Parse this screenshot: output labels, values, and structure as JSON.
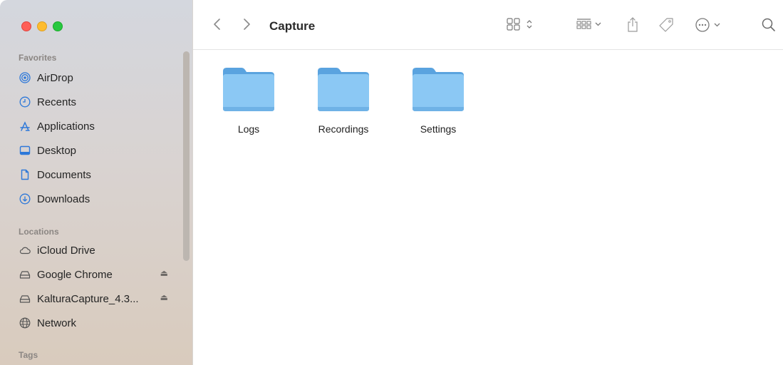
{
  "window": {
    "title": "Capture"
  },
  "sidebar": {
    "sections": [
      {
        "title": "Favorites",
        "items": [
          {
            "label": "AirDrop",
            "icon": "airdrop-icon"
          },
          {
            "label": "Recents",
            "icon": "clock-icon"
          },
          {
            "label": "Applications",
            "icon": "applications-icon"
          },
          {
            "label": "Desktop",
            "icon": "desktop-icon"
          },
          {
            "label": "Documents",
            "icon": "document-icon"
          },
          {
            "label": "Downloads",
            "icon": "download-icon"
          }
        ]
      },
      {
        "title": "Locations",
        "items": [
          {
            "label": "iCloud Drive",
            "icon": "cloud-icon"
          },
          {
            "label": "Google Chrome",
            "icon": "drive-icon",
            "eject": "⏏"
          },
          {
            "label": "KalturaCapture_4.3...",
            "icon": "drive-icon",
            "eject": "⏏"
          },
          {
            "label": "Network",
            "icon": "globe-icon"
          }
        ]
      },
      {
        "title": "Tags",
        "items": []
      }
    ]
  },
  "files": [
    {
      "name": "Logs"
    },
    {
      "name": "Recordings"
    },
    {
      "name": "Settings"
    }
  ],
  "colors": {
    "folder_body": "#8bc8f4",
    "folder_tab": "#5aa3df",
    "accent": "#2d78d9"
  }
}
